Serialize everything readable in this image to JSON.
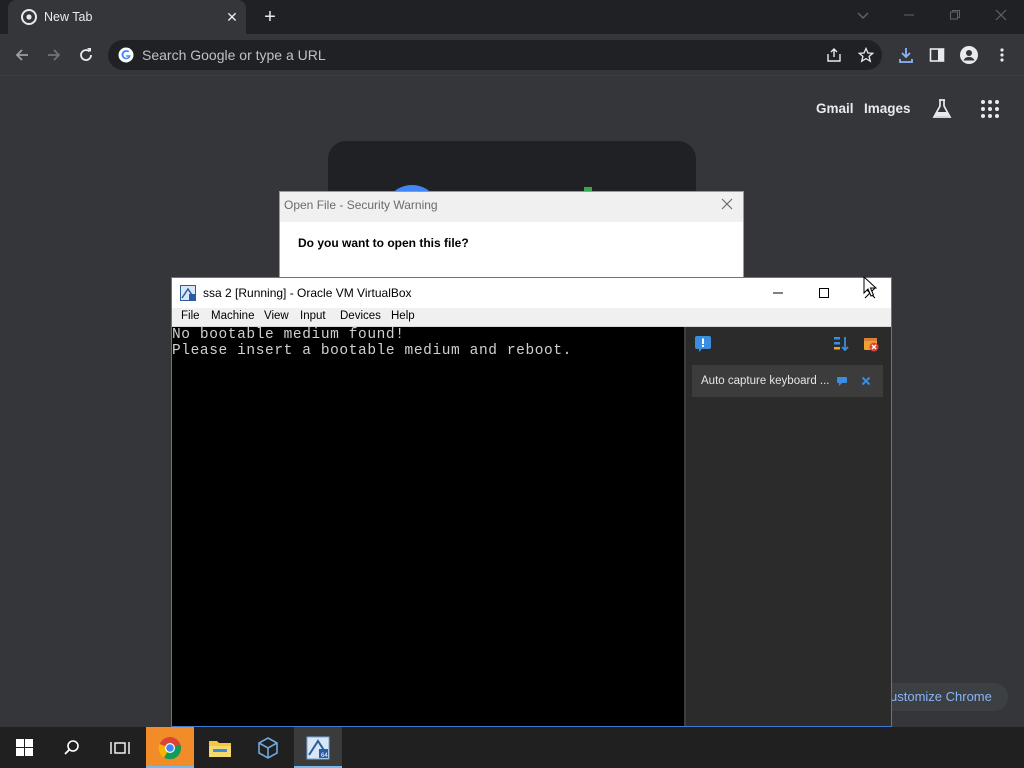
{
  "chrome": {
    "tab": {
      "title": "New Tab"
    },
    "omnibox": {
      "placeholder": "Search Google or type a URL"
    },
    "ntp": {
      "gmail": "Gmail",
      "images": "Images",
      "customize": "ustomize Chrome"
    }
  },
  "dialog": {
    "title": "Open File - Security Warning",
    "question": "Do you want to open this file?"
  },
  "vbox": {
    "title": "ssa 2 [Running] - Oracle VM VirtualBox",
    "menu": [
      "File",
      "Machine",
      "View",
      "Input",
      "Devices",
      "Help"
    ],
    "screen_lines": [
      "No bootable medium found!",
      "Please insert a bootable medium and reboot."
    ],
    "notification": "Auto capture keyboard ..."
  },
  "colors": {
    "chrome_bg": "#35363a",
    "tabstrip_bg": "#202124",
    "link_blue": "#8ab4f8",
    "taskbar_bg": "#202020",
    "taskbar_accent": "#76b9ed"
  },
  "icons": {
    "tab_favicon": "chrome-icon",
    "tab_close": "close-icon",
    "new_tab": "plus-icon",
    "back": "arrow-left-icon",
    "forward": "arrow-right-icon",
    "reload": "reload-icon",
    "share": "share-icon",
    "bookmark": "star-icon",
    "downloads": "download-icon",
    "side_panel": "side-panel-icon",
    "profile": "person-icon",
    "menu": "kebab-icon",
    "labs": "flask-icon",
    "apps": "grid-icon"
  }
}
